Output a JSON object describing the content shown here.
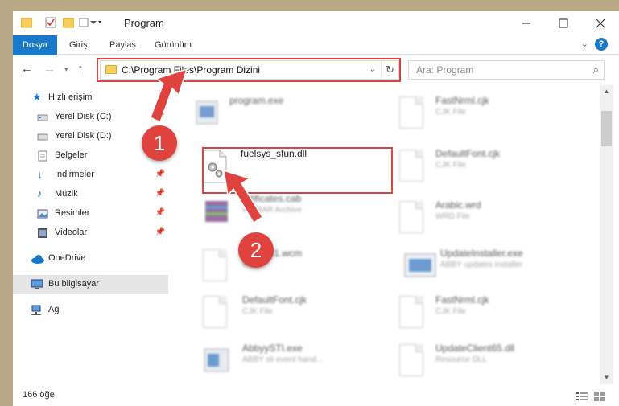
{
  "window": {
    "title": "Program",
    "minimize_icon": "minimize-icon",
    "maximize_icon": "maximize-icon",
    "close_icon": "close-icon"
  },
  "ribbon": {
    "tabs": [
      "Dosya",
      "Giriş",
      "Paylaş",
      "Görünüm"
    ],
    "accent": "#1979ca"
  },
  "nav": {
    "address": "C:\\Program Files\\Program Dizini",
    "search_placeholder": "Ara: Program"
  },
  "sidebar": {
    "items": [
      {
        "label": "Hızlı erişim",
        "icon": "star-icon"
      },
      {
        "label": "Yerel Disk (C:)",
        "icon": "drive-icon"
      },
      {
        "label": "Yerel Disk (D:)",
        "icon": "drive-icon"
      },
      {
        "label": "Belgeler",
        "icon": "documents-icon"
      },
      {
        "label": "İndirmeler",
        "icon": "download-icon"
      },
      {
        "label": "Müzik",
        "icon": "music-icon"
      },
      {
        "label": "Resimler",
        "icon": "pictures-icon"
      },
      {
        "label": "Videolar",
        "icon": "video-icon"
      },
      {
        "label": "OneDrive",
        "icon": "cloud-icon"
      },
      {
        "label": "Bu bilgisayar",
        "icon": "computer-icon"
      },
      {
        "label": "Ağ",
        "icon": "network-icon"
      }
    ]
  },
  "files": [
    {
      "name": "program.exe",
      "type": ""
    },
    {
      "name": "FastNrml.cjk",
      "type": "CJK File"
    },
    {
      "name": "fuelsys_sfun.dll",
      "type": ""
    },
    {
      "name": "DefaultFont.cjk",
      "type": "CJK File"
    },
    {
      "name": "...tificates.cab",
      "type": "WinRAR Archive"
    },
    {
      "name": "Arabic.wrd",
      "type": "WRD File"
    },
    {
      "name": "Sn...P01.wcm",
      "type": "W..."
    },
    {
      "name": "UpdateInstaller.exe",
      "type": "ABBY updates installer"
    },
    {
      "name": "DefaultFont.cjk",
      "type": "CJK File"
    },
    {
      "name": "FastNrml.cjk",
      "type": "CJK File"
    },
    {
      "name": "AbbyySTI.exe",
      "type": "ABBY sti event hand..."
    },
    {
      "name": "UpdateClient65.dll",
      "type": "Resource DLL"
    }
  ],
  "status": {
    "count": "166 öğe"
  },
  "annotations": {
    "step1": "1",
    "step2": "2",
    "highlight_color": "#e0423e"
  }
}
